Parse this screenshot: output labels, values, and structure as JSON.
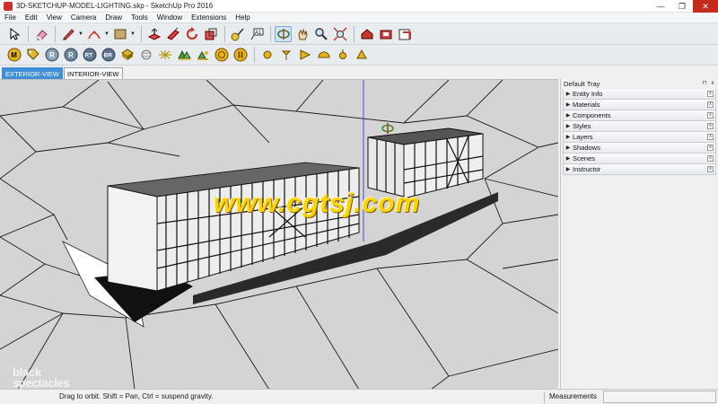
{
  "window": {
    "title": "3D-SKETCHUP-MODEL-LIGHTING.skp - SketchUp Pro 2016",
    "minimize_glyph": "—",
    "maximize_glyph": "❐",
    "close_glyph": "✕"
  },
  "menu": [
    "File",
    "Edit",
    "View",
    "Camera",
    "Draw",
    "Tools",
    "Window",
    "Extensions",
    "Help"
  ],
  "toolbar1": {
    "tools": [
      "select-arrow-icon",
      "eraser-icon",
      "pencil-line-icon",
      "arc-icon",
      "rectangle-icon",
      "push-pull-icon",
      "follow-me-icon",
      "rotate-icon",
      "scale-icon",
      "tape-measure-icon",
      "text-label-icon",
      "orbit-icon",
      "pan-icon",
      "zoom-icon",
      "zoom-extents-icon",
      "warehouse-icon",
      "extension-warehouse-icon",
      "send-to-layout-icon"
    ],
    "active_tool": "orbit-icon"
  },
  "toolbar2": {
    "tools": [
      "plugin-m-icon",
      "plugin-tag-icon",
      "plugin-r-icon",
      "plugin-r2-icon",
      "plugin-rt-icon",
      "plugin-br-icon",
      "plugin-material-icon",
      "plugin-sphere-icon",
      "plugin-light-icon",
      "plugin-tree-icon",
      "plugin-group-icon",
      "plugin-target-icon",
      "plugin-pause-icon",
      "light-omni-icon",
      "light-spot-icon",
      "light-sun-icon",
      "light-dome-icon",
      "light-ies-icon",
      "light-mesh-icon"
    ]
  },
  "scene_tabs": [
    "EXTERIOR-VIEW",
    "INTERIOR-VIEW"
  ],
  "active_scene": "EXTERIOR-VIEW",
  "tray": {
    "title": "Default Tray",
    "pin_glyph": "⊓",
    "close_glyph": "x",
    "panels": [
      "Entity Info",
      "Materials",
      "Components",
      "Styles",
      "Layers",
      "Shadows",
      "Scenes",
      "Instructor"
    ],
    "panel_close_glyph": "x",
    "expand_glyph": "▶"
  },
  "status": {
    "hint": "Drag to orbit. Shift = Pan, Ctrl = suspend gravity.",
    "measurements_label": "Measurements",
    "measurements_value": ""
  },
  "brand": {
    "line1": "black",
    "line2": "spectacles"
  },
  "watermark": "www.cgtsj.com",
  "colors": {
    "active_tab": "#3f8ed8",
    "watermark": "#ffd200",
    "ground": "#d4d4d4"
  }
}
